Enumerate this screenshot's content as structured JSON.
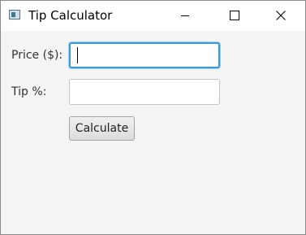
{
  "window": {
    "title": "Tip Calculator",
    "icons": {
      "app": "app-window-icon",
      "minimize": "minimize-icon",
      "maximize": "maximize-icon",
      "close": "close-icon"
    }
  },
  "form": {
    "price_label": "Price ($):",
    "price_value": "",
    "tip_label": "Tip %:",
    "tip_value": "",
    "calculate_label": "Calculate"
  },
  "colors": {
    "focus_border": "#3a9ad9",
    "background": "#f4f4f4"
  }
}
